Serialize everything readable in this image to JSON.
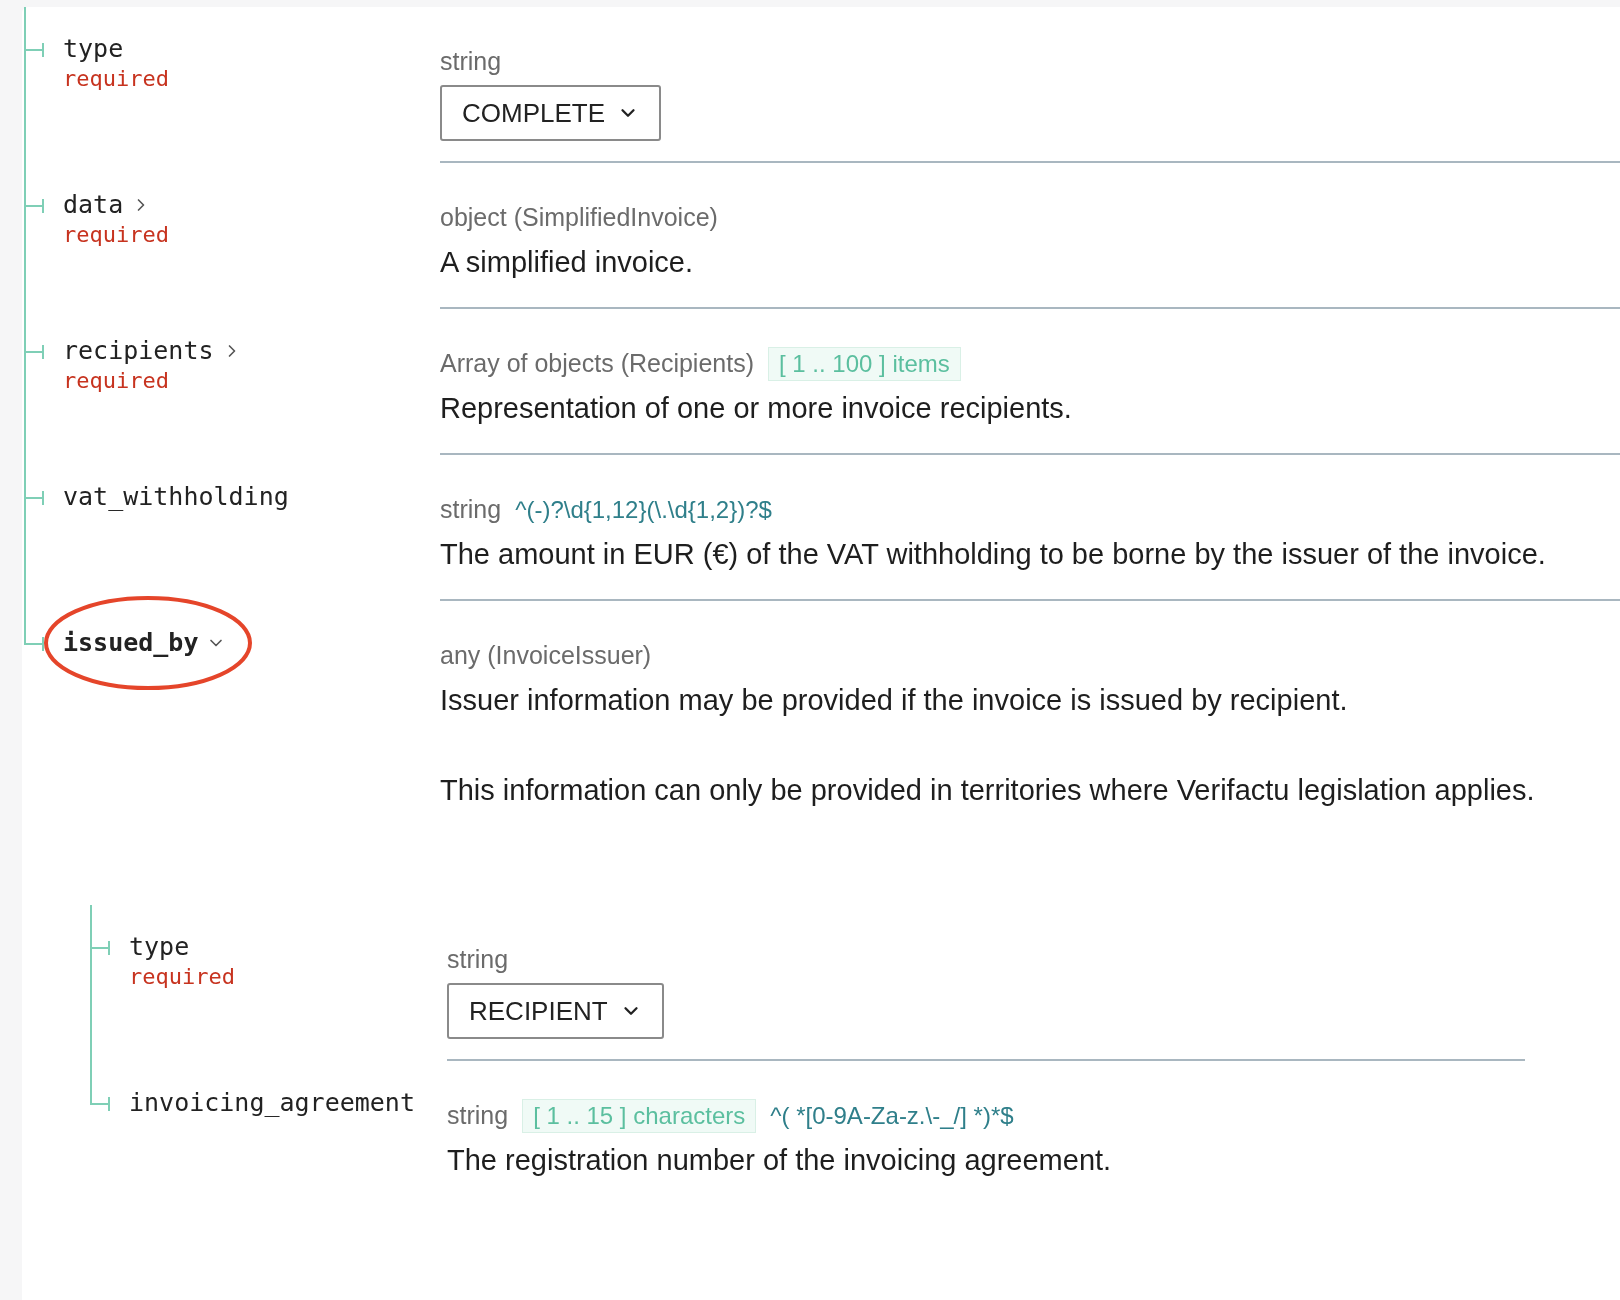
{
  "fields": [
    {
      "name": "type",
      "required": "required",
      "type": "string",
      "select": "COMPLETE"
    },
    {
      "name": "data",
      "required": "required",
      "expanded": false,
      "type": "object (SimplifiedInvoice)",
      "description": [
        "A simplified invoice."
      ]
    },
    {
      "name": "recipients",
      "required": "required",
      "expanded": false,
      "type": "Array of objects (Recipients)",
      "constraint": "[ 1 .. 100 ] items",
      "description": [
        "Representation of one or more invoice recipients."
      ]
    },
    {
      "name": "vat_withholding",
      "type": "string",
      "pattern": "^(-)?\\d{1,12}(\\.\\d{1,2})?$",
      "description": [
        "The amount in EUR (€) of the VAT withholding to be borne by the issuer of the invoice."
      ]
    },
    {
      "name": "issued_by",
      "expanded": true,
      "circled": true,
      "type": "any (InvoiceIssuer)",
      "description": [
        "Issuer information may be provided if the invoice is issued by recipient.",
        "This information can only be provided in territories where Verifactu legislation applies."
      ],
      "children": [
        {
          "name": "type",
          "required": "required",
          "type": "string",
          "select": "RECIPIENT"
        },
        {
          "name": "invoicing_agreement",
          "type": "string",
          "constraint": "[ 1 .. 15 ] characters",
          "pattern": "^( *[0-9A-Za-z.\\-_/] *)*$",
          "description": [
            "The registration number of the invoicing agreement."
          ]
        }
      ]
    }
  ]
}
